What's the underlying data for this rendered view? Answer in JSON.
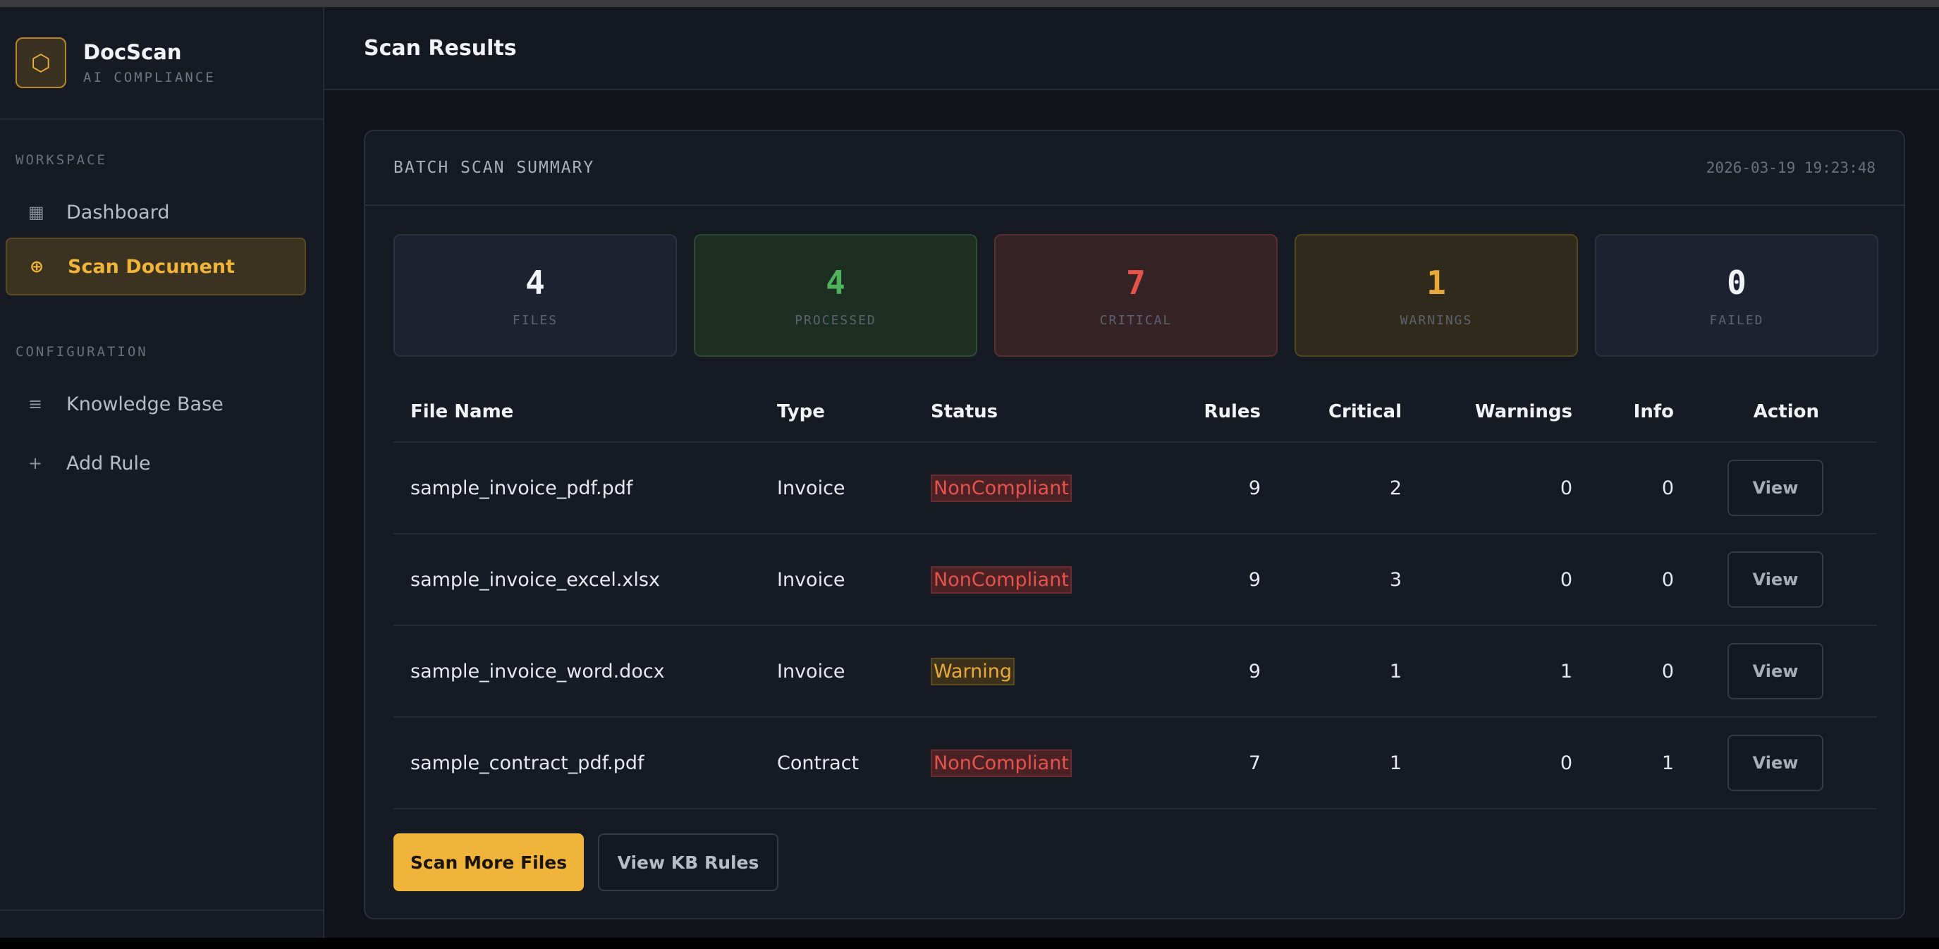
{
  "brand": {
    "name": "DocScan",
    "subtitle": "AI COMPLIANCE",
    "logo_icon": "⬡"
  },
  "sidebar": {
    "sections": [
      {
        "label": "WORKSPACE"
      },
      {
        "label": "CONFIGURATION"
      }
    ],
    "items": [
      {
        "label": "Dashboard",
        "icon": "▦",
        "icon_name": "grid-icon"
      },
      {
        "label": "Scan Document",
        "icon": "⊕",
        "icon_name": "crosshair-icon",
        "active": true
      },
      {
        "label": "Knowledge Base",
        "icon": "≡",
        "icon_name": "list-icon"
      },
      {
        "label": "Add Rule",
        "icon": "+",
        "icon_name": "plus-icon"
      }
    ]
  },
  "header": {
    "title": "Scan Results"
  },
  "summary": {
    "title": "BATCH SCAN SUMMARY",
    "timestamp": "2026-03-19 19:23:48",
    "stats": [
      {
        "value": "4",
        "label": "FILES"
      },
      {
        "value": "4",
        "label": "PROCESSED"
      },
      {
        "value": "7",
        "label": "CRITICAL"
      },
      {
        "value": "1",
        "label": "WARNINGS"
      },
      {
        "value": "0",
        "label": "FAILED"
      }
    ]
  },
  "table": {
    "columns": [
      "File Name",
      "Type",
      "Status",
      "Rules",
      "Critical",
      "Warnings",
      "Info",
      "Action"
    ],
    "rows": [
      {
        "file": "sample_invoice_pdf.pdf",
        "type": "Invoice",
        "status": "NonCompliant",
        "rules": "9",
        "critical": "2",
        "warnings": "0",
        "info": "0",
        "action": "View"
      },
      {
        "file": "sample_invoice_excel.xlsx",
        "type": "Invoice",
        "status": "NonCompliant",
        "rules": "9",
        "critical": "3",
        "warnings": "0",
        "info": "0",
        "action": "View"
      },
      {
        "file": "sample_invoice_word.docx",
        "type": "Invoice",
        "status": "Warning",
        "rules": "9",
        "critical": "1",
        "warnings": "1",
        "info": "0",
        "action": "View"
      },
      {
        "file": "sample_contract_pdf.pdf",
        "type": "Contract",
        "status": "NonCompliant",
        "rules": "7",
        "critical": "1",
        "warnings": "0",
        "info": "1",
        "action": "View"
      }
    ]
  },
  "actions": {
    "primary": "Scan More Files",
    "secondary": "View KB Rules"
  },
  "colors": {
    "accent": "#f0b43a",
    "critical": "#e5534b",
    "success": "#4fb35e",
    "warning": "#e8a93a"
  }
}
